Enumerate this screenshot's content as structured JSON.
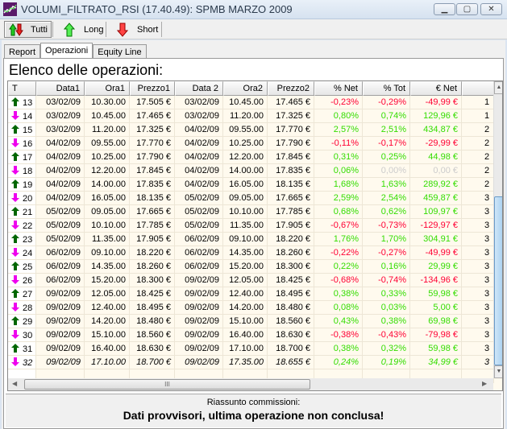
{
  "window": {
    "title": "VOLUMI_FILTRATO_RSI (17.40.49): SPMB MARZO 2009"
  },
  "toolbar": {
    "buttons": [
      {
        "label": "Tutti",
        "icon": "up-down-arrow-icon",
        "active": true
      },
      {
        "label": "Long",
        "icon": "green-up-arrow-icon"
      },
      {
        "label": "Short",
        "icon": "red-down-arrow-icon"
      }
    ]
  },
  "tabs": [
    {
      "label": "Report"
    },
    {
      "label": "Operazioni",
      "selected": true
    },
    {
      "label": "Equity Line"
    }
  ],
  "heading": "Elenco delle operazioni:",
  "colors": {
    "negative": "#ff0033",
    "positive": "#33dd00",
    "zero": "#cccccc",
    "long_arrow": "#006600",
    "short_arrow": "#ee00ee",
    "row_bg": "#fffaee"
  },
  "table": {
    "columns": [
      "T",
      "Data1",
      "Ora1",
      "Prezzo1",
      "Data 2",
      "Ora2",
      "Prezzo2",
      "% Net",
      "% Tot",
      "€ Net",
      ""
    ],
    "rows": [
      [
        "long",
        "13",
        "03/02/09",
        "10.30.00",
        "17.505 €",
        "03/02/09",
        "10.45.00",
        "17.465 €",
        "-0,23%",
        "-0,29%",
        "-49,99 €",
        "1"
      ],
      [
        "short",
        "14",
        "03/02/09",
        "10.45.00",
        "17.465 €",
        "03/02/09",
        "11.20.00",
        "17.325 €",
        "0,80%",
        "0,74%",
        "129,96 €",
        "1"
      ],
      [
        "long",
        "15",
        "03/02/09",
        "11.20.00",
        "17.325 €",
        "04/02/09",
        "09.55.00",
        "17.770 €",
        "2,57%",
        "2,51%",
        "434,87 €",
        "2"
      ],
      [
        "short",
        "16",
        "04/02/09",
        "09.55.00",
        "17.770 €",
        "04/02/09",
        "10.25.00",
        "17.790 €",
        "-0,11%",
        "-0,17%",
        "-29,99 €",
        "2"
      ],
      [
        "long",
        "17",
        "04/02/09",
        "10.25.00",
        "17.790 €",
        "04/02/09",
        "12.20.00",
        "17.845 €",
        "0,31%",
        "0,25%",
        "44,98 €",
        "2"
      ],
      [
        "short",
        "18",
        "04/02/09",
        "12.20.00",
        "17.845 €",
        "04/02/09",
        "14.00.00",
        "17.835 €",
        "0,06%",
        "0,00%",
        "0,00 €",
        "2"
      ],
      [
        "long",
        "19",
        "04/02/09",
        "14.00.00",
        "17.835 €",
        "04/02/09",
        "16.05.00",
        "18.135 €",
        "1,68%",
        "1,63%",
        "289,92 €",
        "2"
      ],
      [
        "short",
        "20",
        "04/02/09",
        "16.05.00",
        "18.135 €",
        "05/02/09",
        "09.05.00",
        "17.665 €",
        "2,59%",
        "2,54%",
        "459,87 €",
        "3"
      ],
      [
        "long",
        "21",
        "05/02/09",
        "09.05.00",
        "17.665 €",
        "05/02/09",
        "10.10.00",
        "17.785 €",
        "0,68%",
        "0,62%",
        "109,97 €",
        "3"
      ],
      [
        "short",
        "22",
        "05/02/09",
        "10.10.00",
        "17.785 €",
        "05/02/09",
        "11.35.00",
        "17.905 €",
        "-0,67%",
        "-0,73%",
        "-129,97 €",
        "3"
      ],
      [
        "long",
        "23",
        "05/02/09",
        "11.35.00",
        "17.905 €",
        "06/02/09",
        "09.10.00",
        "18.220 €",
        "1,76%",
        "1,70%",
        "304,91 €",
        "3"
      ],
      [
        "short",
        "24",
        "06/02/09",
        "09.10.00",
        "18.220 €",
        "06/02/09",
        "14.35.00",
        "18.260 €",
        "-0,22%",
        "-0,27%",
        "-49,99 €",
        "3"
      ],
      [
        "long",
        "25",
        "06/02/09",
        "14.35.00",
        "18.260 €",
        "06/02/09",
        "15.20.00",
        "18.300 €",
        "0,22%",
        "0,16%",
        "29,99 €",
        "3"
      ],
      [
        "short",
        "26",
        "06/02/09",
        "15.20.00",
        "18.300 €",
        "09/02/09",
        "12.05.00",
        "18.425 €",
        "-0,68%",
        "-0,74%",
        "-134,96 €",
        "3"
      ],
      [
        "long",
        "27",
        "09/02/09",
        "12.05.00",
        "18.425 €",
        "09/02/09",
        "12.40.00",
        "18.495 €",
        "0,38%",
        "0,33%",
        "59,98 €",
        "3"
      ],
      [
        "short",
        "28",
        "09/02/09",
        "12.40.00",
        "18.495 €",
        "09/02/09",
        "14.20.00",
        "18.480 €",
        "0,08%",
        "0,03%",
        "5,00 €",
        "3"
      ],
      [
        "long",
        "29",
        "09/02/09",
        "14.20.00",
        "18.480 €",
        "09/02/09",
        "15.10.00",
        "18.560 €",
        "0,43%",
        "0,38%",
        "69,98 €",
        "3"
      ],
      [
        "short",
        "30",
        "09/02/09",
        "15.10.00",
        "18.560 €",
        "09/02/09",
        "16.40.00",
        "18.630 €",
        "-0,38%",
        "-0,43%",
        "-79,98 €",
        "3"
      ],
      [
        "long",
        "31",
        "09/02/09",
        "16.40.00",
        "18.630 €",
        "09/02/09",
        "17.10.00",
        "18.700 €",
        "0,38%",
        "0,32%",
        "59,98 €",
        "3"
      ],
      [
        "short",
        "32",
        "09/02/09",
        "17.10.00",
        "18.700 €",
        "09/02/09",
        "17.35.00",
        "18.655 €",
        "0,24%",
        "0,19%",
        "34,99 €",
        "3"
      ]
    ]
  },
  "footer": {
    "label": "Riassunto commissioni:",
    "message": "Dati provvisori, ultima operazione non conclusa!"
  }
}
